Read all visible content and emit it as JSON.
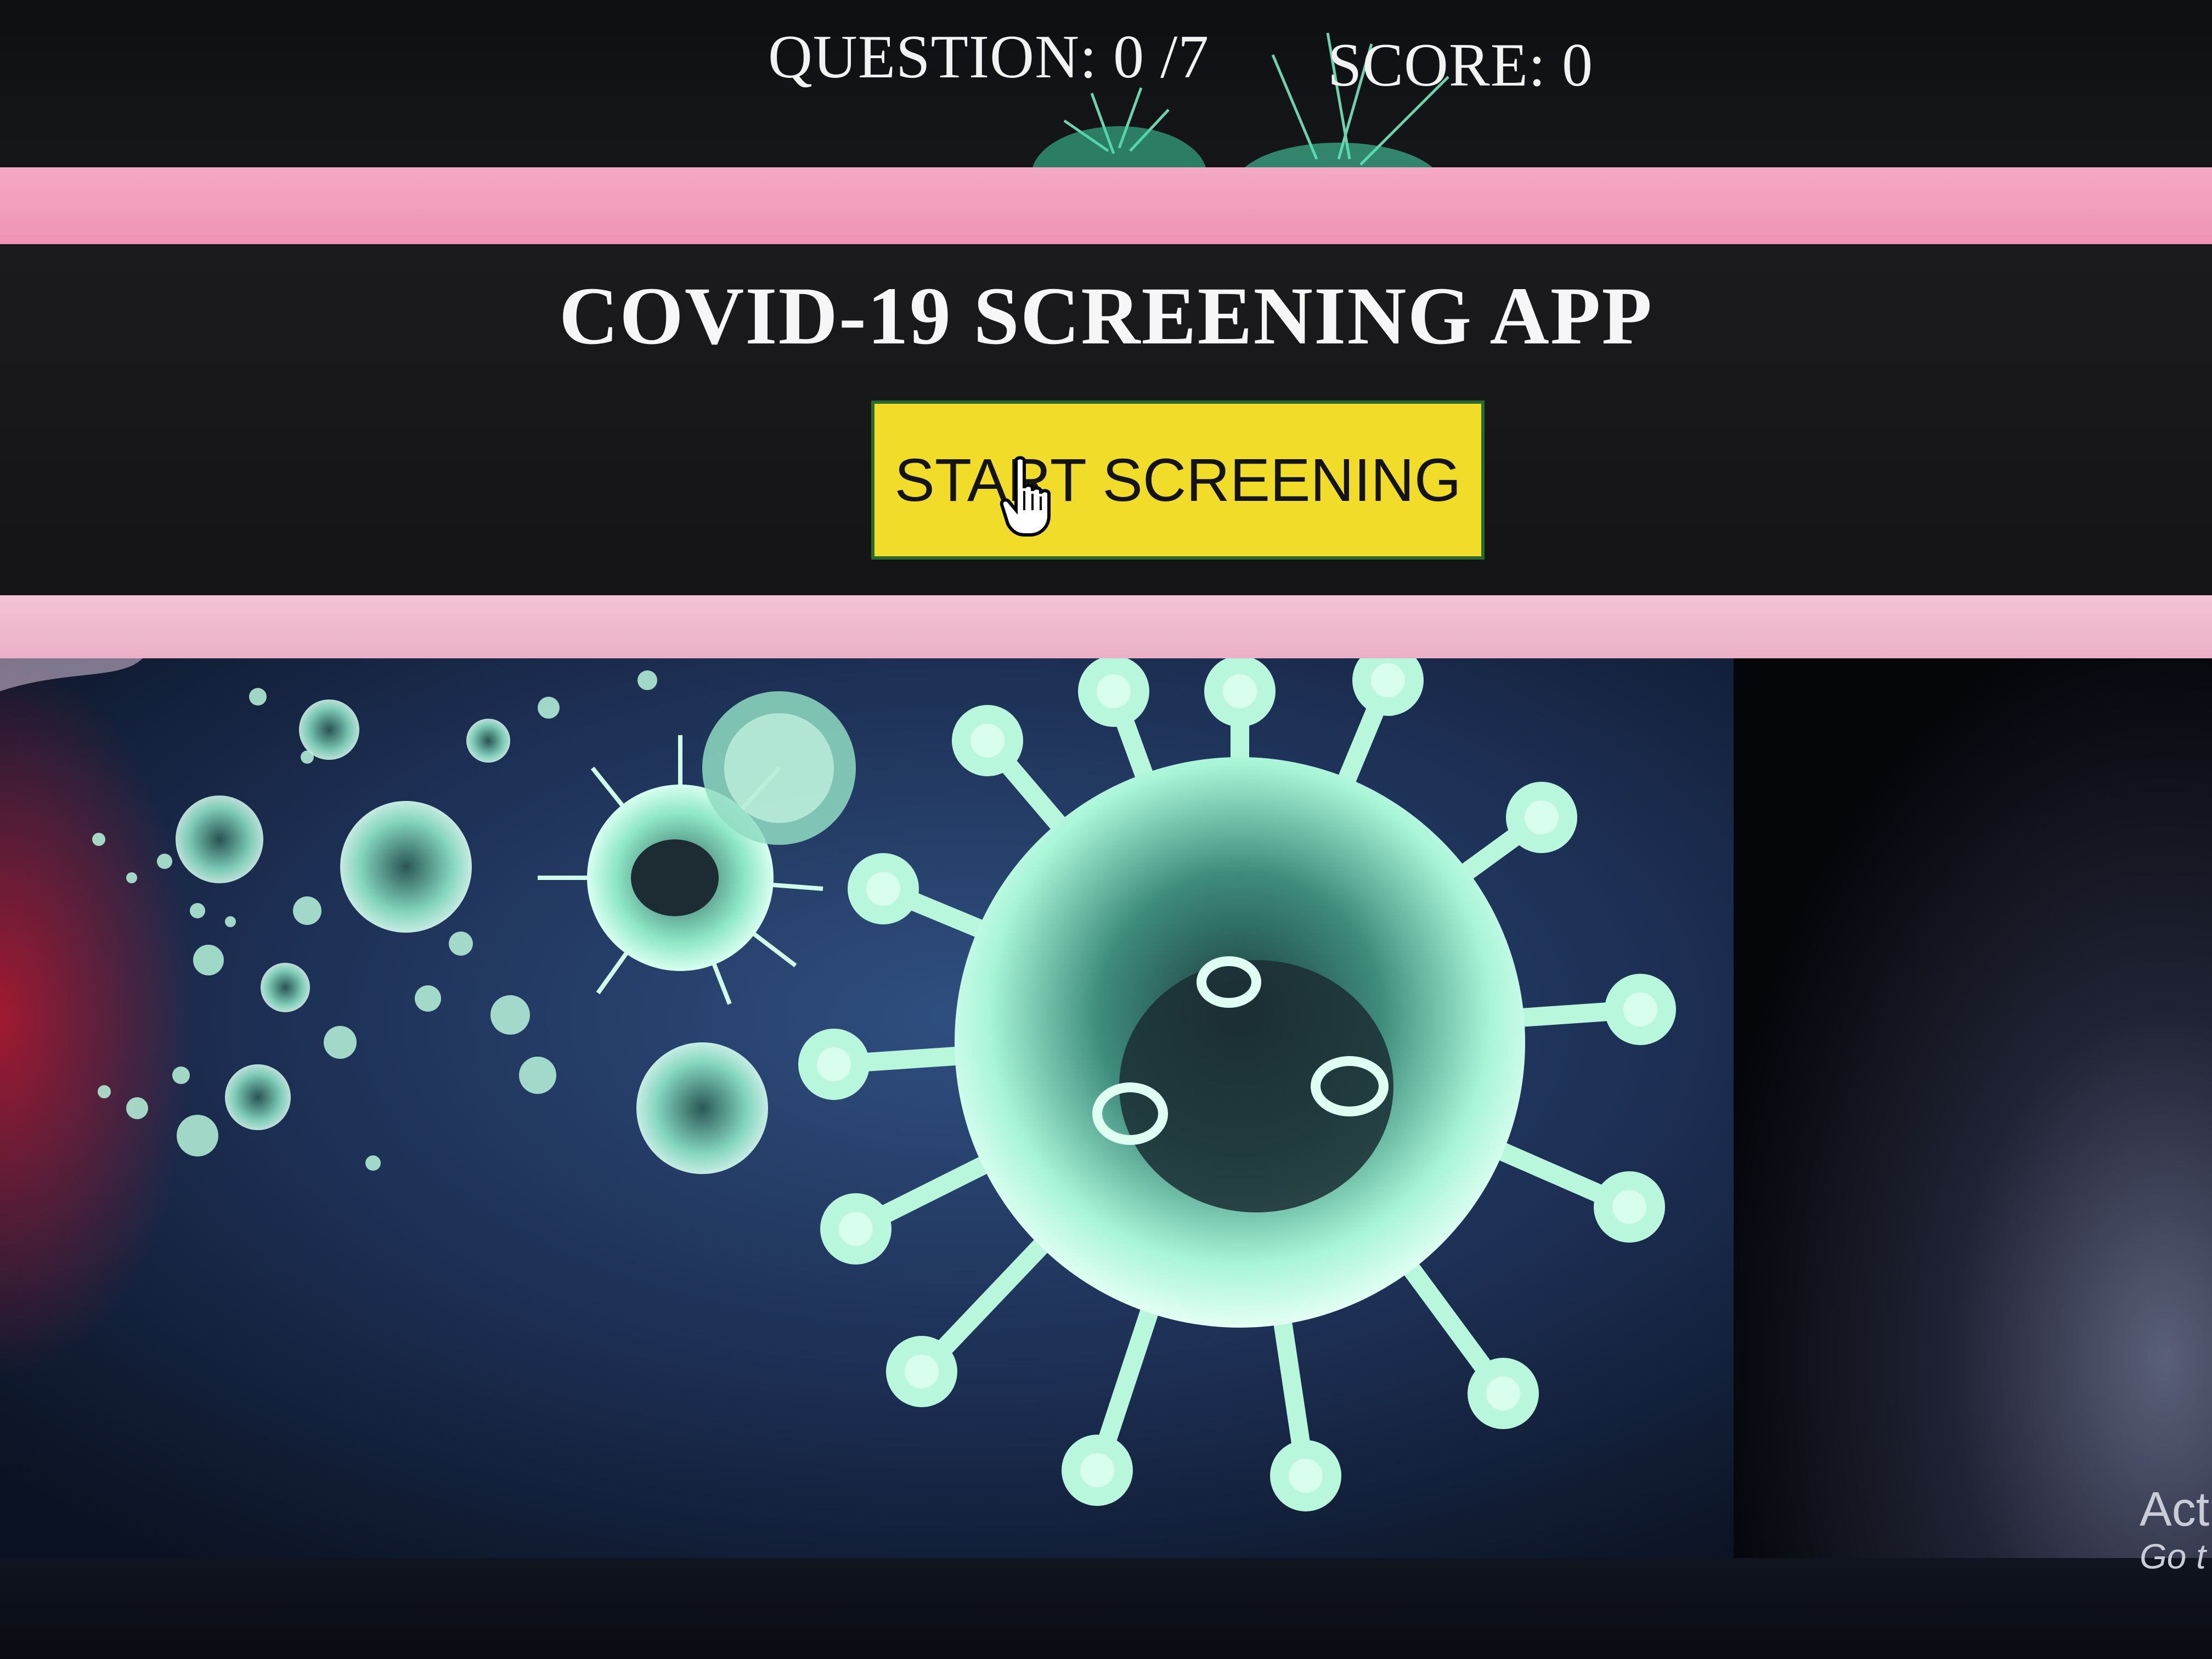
{
  "hud": {
    "question_label": "QUESTION: 0 /7",
    "score_label": "SCORE: 0"
  },
  "main": {
    "title": "COVID-19 SCREENING APP",
    "start_button_label": "START SCREENING"
  },
  "watermark": {
    "line1": "Act",
    "line2": "Go t"
  },
  "colors": {
    "pink_band": "#ef93b6",
    "button_yellow": "#f1dc2a",
    "button_border": "#2c6a2c",
    "panel_dark": "#1b1b1d",
    "virus_glow": "#9fffe0"
  },
  "icons": [
    "hand-pointer-cursor-icon",
    "virus-illustration"
  ]
}
